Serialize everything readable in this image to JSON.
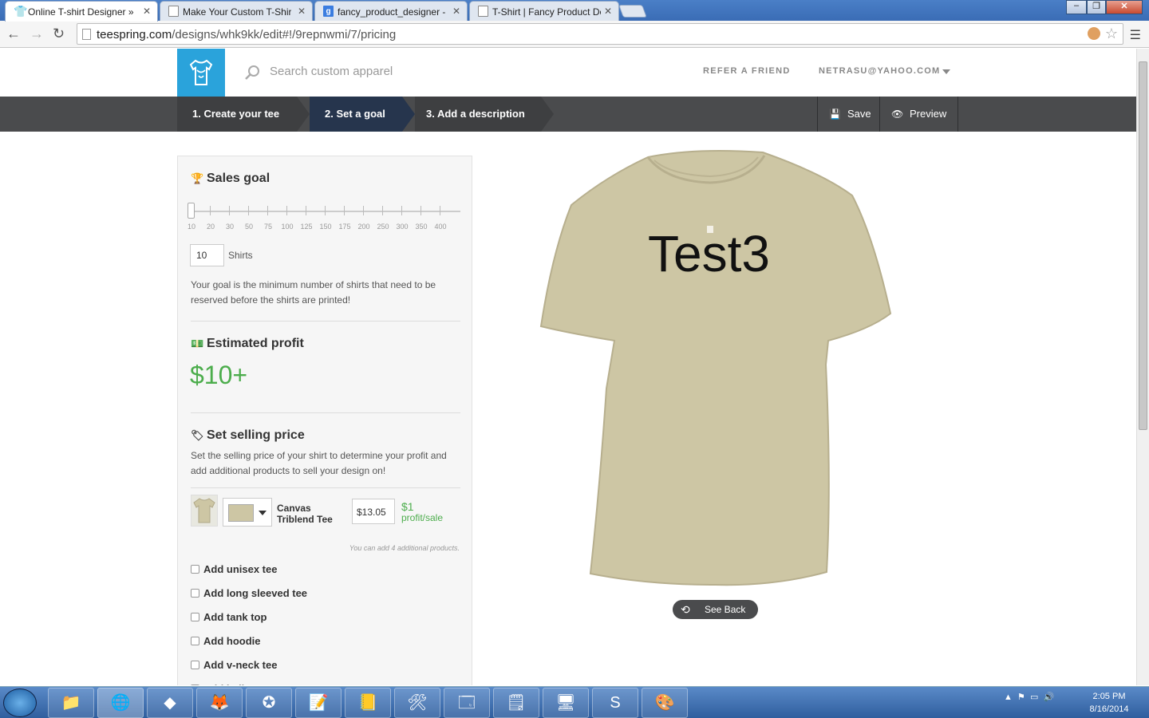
{
  "browser": {
    "tabs": [
      {
        "title": "Online T-shirt Designer » E",
        "close": "✕",
        "active": true
      },
      {
        "title": "Make Your Custom T-Shirt",
        "close": "✕",
        "active": false
      },
      {
        "title": "fancy_product_designer -",
        "close": "✕",
        "active": false
      },
      {
        "title": "T-Shirt | Fancy Product De",
        "close": "✕",
        "active": false
      }
    ],
    "url_host": "teespring.com",
    "url_path": "/designs/whk9kk/edit#!/9repnwmi/7/pricing"
  },
  "header": {
    "search_placeholder": "Search custom apparel",
    "refer": "REFER A FRIEND",
    "account": "NETRASU@YAHOO.COM"
  },
  "steps": {
    "items": [
      {
        "label": "1. Create your tee"
      },
      {
        "label": "2. Set a goal"
      },
      {
        "label": "3. Add a description"
      }
    ],
    "save": "Save",
    "preview": "Preview"
  },
  "panel": {
    "sales_goal_title": "Sales goal",
    "ticks": [
      "10",
      "20",
      "30",
      "50",
      "75",
      "100",
      "125",
      "150",
      "175",
      "200",
      "250",
      "300",
      "350",
      "400"
    ],
    "slider_value": 10,
    "goal_value": "10",
    "goal_unit": "Shirts",
    "goal_help": "Your goal is the minimum number of shirts that need to be reserved before the shirts are printed!",
    "profit_title": "Estimated profit",
    "profit_value": "$10+",
    "price_title": "Set selling price",
    "price_help": "Set the selling price of your shirt to determine your profit and add additional products to sell your design on!",
    "product_name": "Canvas Triblend Tee",
    "product_color": "#cdc6a4",
    "price": "$13.05",
    "profit_per": "$1",
    "profit_per_label": "profit/sale",
    "additional_note": "You can add 4 additional products.",
    "add_options": [
      "Add unisex tee",
      "Add long sleeved tee",
      "Add tank top",
      "Add hoodie",
      "Add v-neck tee",
      "Add ladies tee"
    ]
  },
  "preview": {
    "shirt_text": "Test3",
    "see_back": "See Back"
  },
  "taskbar": {
    "time": "2:05 PM",
    "date": "8/16/2014"
  },
  "colors": {
    "accent": "#2aa3db",
    "profit_green": "#4cad4c",
    "stepbar": "#4a4b4d",
    "active_step": "#26354d"
  }
}
